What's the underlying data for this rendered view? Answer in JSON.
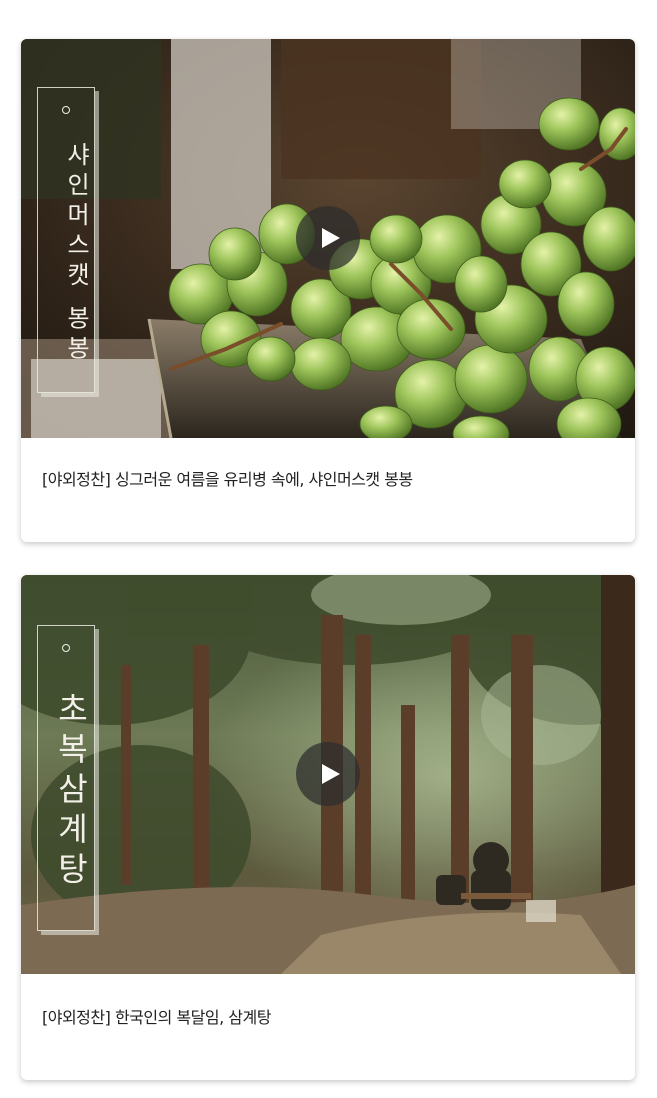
{
  "cards": [
    {
      "vertical_label": "샤인머스캣 봉봉",
      "title": "[야외정찬] 싱그러운 여름을 유리병 속에, 샤인머스캣 봉봉"
    },
    {
      "vertical_label": "초복삼계탕",
      "title": "[야외정찬] 한국인의 복달임, 삼계탕"
    }
  ]
}
